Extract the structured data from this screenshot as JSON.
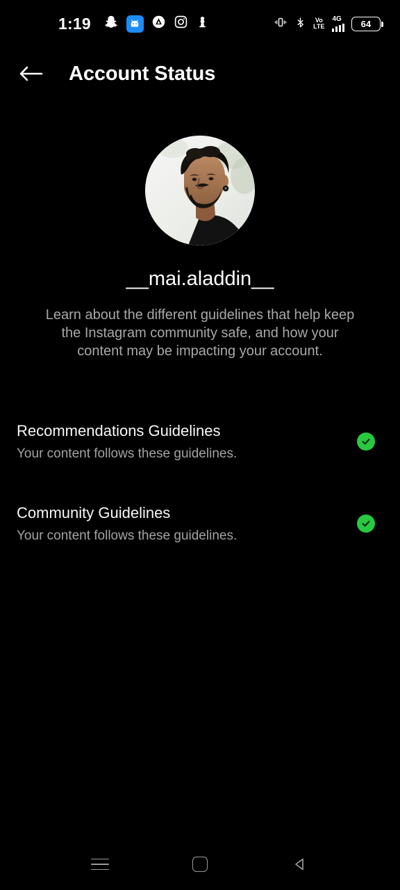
{
  "status_bar": {
    "time": "1:19",
    "left_icons": [
      {
        "name": "snapchat-icon",
        "label": "Snapchat"
      },
      {
        "name": "android-app-icon",
        "label": "App"
      },
      {
        "name": "adguard-icon",
        "label": "AdGuard"
      },
      {
        "name": "instagram-icon",
        "label": "Instagram"
      },
      {
        "name": "pawn-app-icon",
        "label": "App"
      }
    ],
    "right_icons": [
      {
        "name": "vibrate-icon",
        "label": "Vibrate"
      },
      {
        "name": "bluetooth-icon",
        "label": "Bluetooth"
      }
    ],
    "volte_top": "Vo",
    "volte_bottom": "LTE",
    "network_type": "4G",
    "battery_level": "64"
  },
  "header": {
    "title": "Account Status",
    "back_label": "Back"
  },
  "profile": {
    "username": "__mai.aladdin__",
    "description": "Learn about the different guidelines that help keep the Instagram community safe, and how your content may be impacting your account.",
    "avatar_alt": "Profile photo"
  },
  "guidelines": [
    {
      "title": "Recommendations Guidelines",
      "subtitle": "Your content follows these guidelines.",
      "status": "ok",
      "status_color": "#28c840"
    },
    {
      "title": "Community Guidelines",
      "subtitle": "Your content follows these guidelines.",
      "status": "ok",
      "status_color": "#28c840"
    }
  ],
  "navbar": {
    "recents_label": "Recents",
    "home_label": "Home",
    "back_label": "Back"
  }
}
